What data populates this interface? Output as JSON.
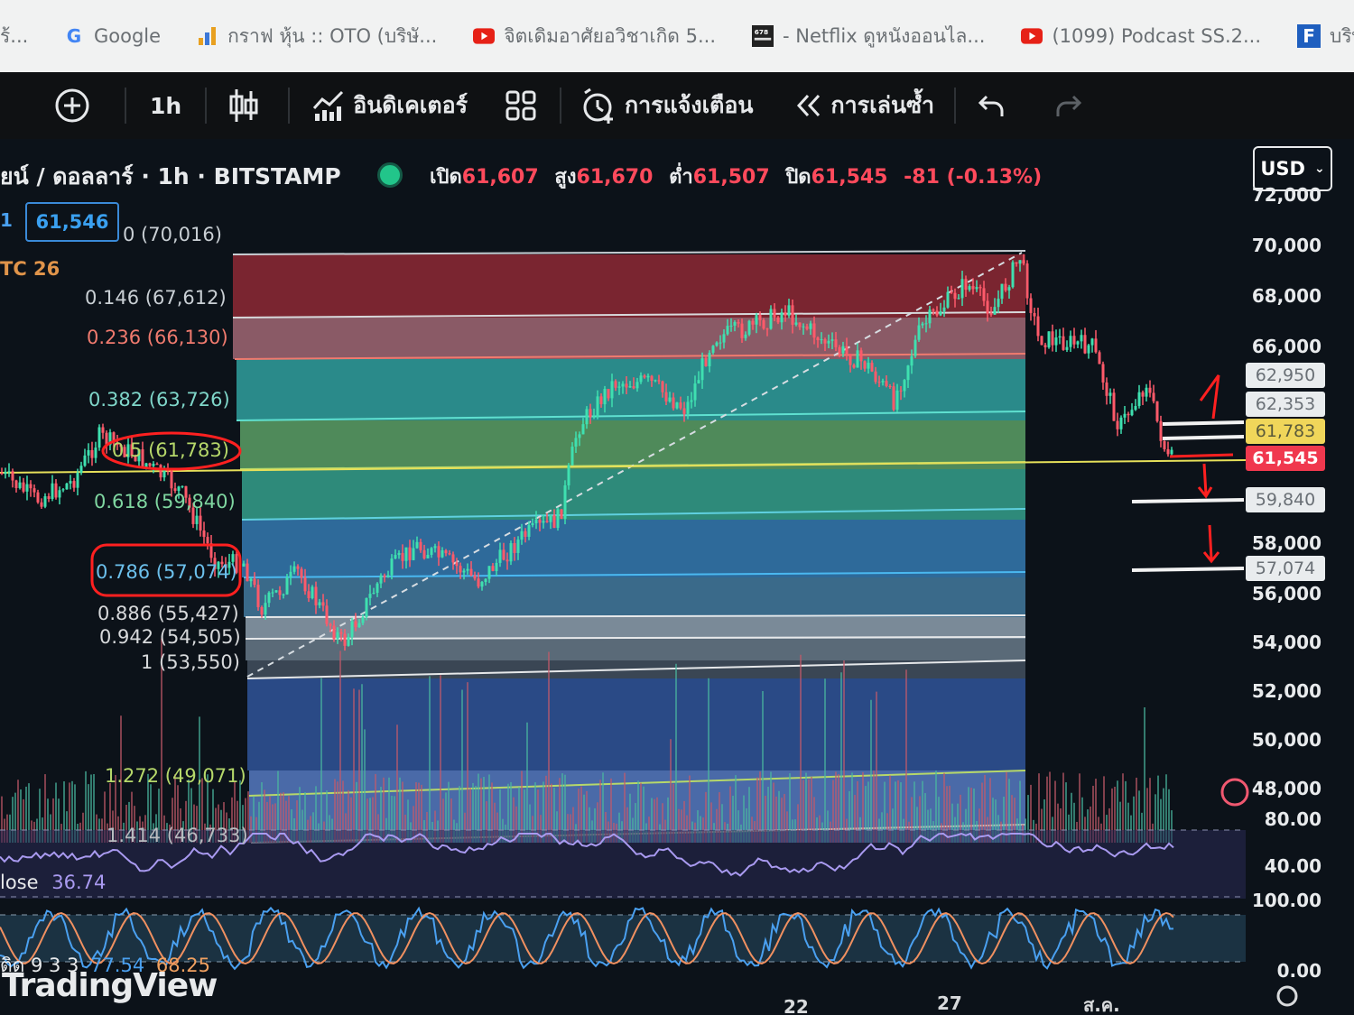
{
  "bookmarks": [
    {
      "icon": "g-icon",
      "label": "Google"
    },
    {
      "icon": "bar-chart-icon",
      "label": "กราฟ หุ้น :: OTO (บริษั..."
    },
    {
      "icon": "youtube-icon",
      "label": "จิตเดิมอาศัยอวิชาเกิด 5..."
    },
    {
      "icon": "movie-icon",
      "label": "- Netflix ดูหนังออนไล..."
    },
    {
      "icon": "youtube-icon",
      "label": "(1099) Podcast SS.2..."
    },
    {
      "icon": "f-icon",
      "label": "บริษัทหลักทรั"
    }
  ],
  "toolbar": {
    "interval": "1h",
    "indicators": "อินดิเคเตอร์",
    "alerts": "การแจ้งเตือน",
    "replay": "การเล่นซ้ำ"
  },
  "header": {
    "symbol": "ยน์ / ดอลลาร์ · 1h · BITSTAMP",
    "open_label": "เปิด",
    "open": "61,607",
    "high_label": "สูง",
    "high": "61,670",
    "low_label": "ต่ำ",
    "low": "61,507",
    "close_label": "ปิด",
    "close": "61,545",
    "change": "-81 (-0.13%)",
    "currency": "USD",
    "price_box": "61,546",
    "row2": "TC  26",
    "row1_prefix": "1"
  },
  "fib_levels": [
    {
      "label": "0 (70,016)",
      "color": "#c9cfd4"
    },
    {
      "label": "0.146 (67,612)",
      "color": "#c9cfd4"
    },
    {
      "label": "0.236 (66,130)",
      "color": "#f07a6e"
    },
    {
      "label": "0.382 (63,726)",
      "color": "#7fd6c9"
    },
    {
      "label": "0.5 (61,783)",
      "color": "#b6d86a"
    },
    {
      "label": "0.618 (59,840)",
      "color": "#7fd6a0"
    },
    {
      "label": "0.786 (57,074)",
      "color": "#6cc0ec"
    },
    {
      "label": "0.886 (55,427)",
      "color": "#d7d9db"
    },
    {
      "label": "0.942 (54,505)",
      "color": "#d7d9db"
    },
    {
      "label": "1 (53,550)",
      "color": "#d7d9db"
    },
    {
      "label": "1.272 (49,071)",
      "color": "#b6d86a"
    },
    {
      "label": "1.414 (46,733)",
      "color": "#b8bcc0"
    }
  ],
  "price_axis": [
    "72,000",
    "70,000",
    "68,000",
    "66,000",
    "58,000",
    "56,000",
    "54,000",
    "52,000",
    "50,000",
    "48,000"
  ],
  "price_tags": [
    {
      "label": "62,950",
      "bg": "#e9ecee",
      "fg": "#6a7076"
    },
    {
      "label": "62,353",
      "bg": "#e9ecee",
      "fg": "#6a7076"
    },
    {
      "label": "61,783",
      "bg": "#f0d65a",
      "fg": "#5a5a3a"
    },
    {
      "label": "61,545",
      "bg": "#f0384e",
      "fg": "#ffffff"
    },
    {
      "label": "59,840",
      "bg": "#e9ecee",
      "fg": "#6a7076"
    },
    {
      "label": "57,074",
      "bg": "#e9ecee",
      "fg": "#6a7076"
    }
  ],
  "rsi": {
    "label": "lose",
    "value": "36.74",
    "axis_top": "80.00",
    "axis_mid": "40.00"
  },
  "stoch": {
    "label": "ติด 9 3 3",
    "k": "77.54",
    "d": "68.25",
    "axis_top": "100.00",
    "axis_bottom": "0.00"
  },
  "time_axis": [
    "22",
    "27",
    "ส.ค."
  ],
  "brand": "TradingView"
}
